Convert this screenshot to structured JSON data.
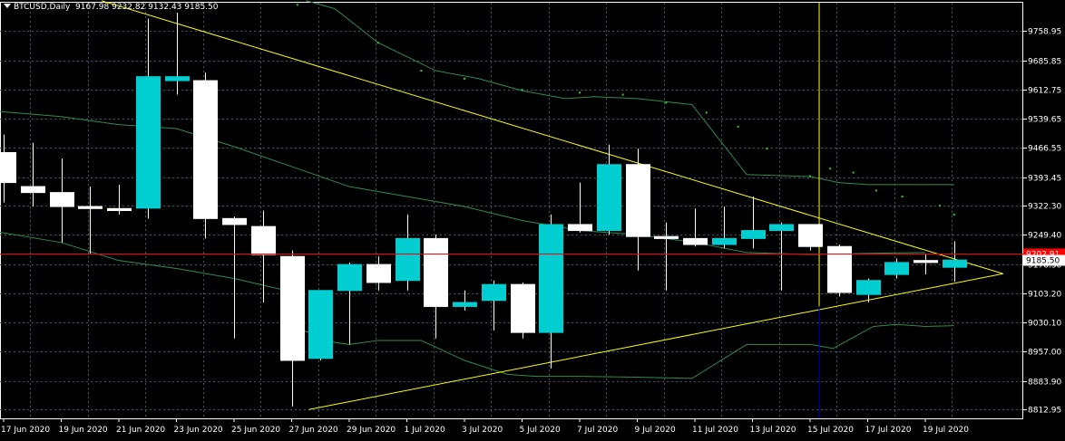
{
  "header": {
    "symbol": "BTCUSD,Daily",
    "ohlc": "9167.98 9232.82 9132.43 9185.50"
  },
  "colors": {
    "background": "#000000",
    "grid": "#415a6a",
    "bull": "#00ced1",
    "bear": "#ffffff",
    "wick": "#ffffff",
    "trendline": "#ffff00",
    "vline": "#ffff00",
    "vline_lower": "#0000cd",
    "ma": "#2e8b57",
    "dots": "#32cd32",
    "red_line": "#ff0000",
    "axis_text": "#ffffff"
  },
  "chart_data": {
    "type": "candlestick",
    "y_range": [
      8790,
      9830
    ],
    "y_ticks": [
      "9758.95",
      "9685.85",
      "9612.75",
      "9539.65",
      "9466.55",
      "9393.45",
      "9322.30",
      "9249.40",
      "9176.30",
      "9103.20",
      "9030.10",
      "8957.00",
      "8883.90",
      "8812.95"
    ],
    "x_ticks": [
      {
        "i": 0,
        "label": "17 Jun 2020"
      },
      {
        "i": 2,
        "label": "19 Jun 2020"
      },
      {
        "i": 4,
        "label": "21 Jun 2020"
      },
      {
        "i": 6,
        "label": "23 Jun 2020"
      },
      {
        "i": 8,
        "label": "25 Jun 2020"
      },
      {
        "i": 10,
        "label": "27 Jun 2020"
      },
      {
        "i": 12,
        "label": "29 Jun 2020"
      },
      {
        "i": 14,
        "label": "1 Jul 2020"
      },
      {
        "i": 16,
        "label": "3 Jul 2020"
      },
      {
        "i": 18,
        "label": "5 Jul 2020"
      },
      {
        "i": 20,
        "label": "7 Jul 2020"
      },
      {
        "i": 22,
        "label": "9 Jul 2020"
      },
      {
        "i": 24,
        "label": "11 Jul 2020"
      },
      {
        "i": 26,
        "label": "13 Jul 2020"
      },
      {
        "i": 28,
        "label": "15 Jul 2020"
      },
      {
        "i": 30,
        "label": "17 Jul 2020"
      },
      {
        "i": 32,
        "label": "19 Jul 2020"
      }
    ],
    "candles": [
      {
        "o": 9455,
        "h": 9500,
        "l": 9330,
        "c": 9380
      },
      {
        "o": 9370,
        "h": 9480,
        "l": 9320,
        "c": 9355
      },
      {
        "o": 9355,
        "h": 9440,
        "l": 9230,
        "c": 9320
      },
      {
        "o": 9320,
        "h": 9370,
        "l": 9200,
        "c": 9315
      },
      {
        "o": 9315,
        "h": 9375,
        "l": 9300,
        "c": 9310
      },
      {
        "o": 9316,
        "h": 9790,
        "l": 9290,
        "c": 9645
      },
      {
        "o": 9635,
        "h": 9805,
        "l": 9600,
        "c": 9645
      },
      {
        "o": 9635,
        "h": 9655,
        "l": 9240,
        "c": 9290
      },
      {
        "o": 9290,
        "h": 9295,
        "l": 8990,
        "c": 9275
      },
      {
        "o": 9270,
        "h": 9310,
        "l": 9080,
        "c": 9200
      },
      {
        "o": 9195,
        "h": 9210,
        "l": 8820,
        "c": 8935
      },
      {
        "o": 8940,
        "h": 9110,
        "l": 8935,
        "c": 9110
      },
      {
        "o": 9110,
        "h": 9180,
        "l": 8975,
        "c": 9175
      },
      {
        "o": 9175,
        "h": 9195,
        "l": 9110,
        "c": 9130
      },
      {
        "o": 9135,
        "h": 9300,
        "l": 9110,
        "c": 9240
      },
      {
        "o": 9240,
        "h": 9250,
        "l": 8990,
        "c": 9070
      },
      {
        "o": 9070,
        "h": 9110,
        "l": 9060,
        "c": 9080
      },
      {
        "o": 9085,
        "h": 9135,
        "l": 9010,
        "c": 9125
      },
      {
        "o": 9125,
        "h": 9130,
        "l": 8990,
        "c": 9005
      },
      {
        "o": 9005,
        "h": 9300,
        "l": 8915,
        "c": 9275
      },
      {
        "o": 9275,
        "h": 9380,
        "l": 9255,
        "c": 9260
      },
      {
        "o": 9260,
        "h": 9475,
        "l": 9250,
        "c": 9425
      },
      {
        "o": 9425,
        "h": 9465,
        "l": 9160,
        "c": 9245
      },
      {
        "o": 9245,
        "h": 9280,
        "l": 9110,
        "c": 9240
      },
      {
        "o": 9240,
        "h": 9315,
        "l": 9220,
        "c": 9225
      },
      {
        "o": 9225,
        "h": 9320,
        "l": 9215,
        "c": 9240
      },
      {
        "o": 9240,
        "h": 9345,
        "l": 9215,
        "c": 9260
      },
      {
        "o": 9260,
        "h": 9280,
        "l": 9110,
        "c": 9275
      },
      {
        "o": 9275,
        "h": 9275,
        "l": 9210,
        "c": 9220
      },
      {
        "o": 9220,
        "h": 9225,
        "l": 9095,
        "c": 9105
      },
      {
        "o": 9100,
        "h": 9140,
        "l": 9080,
        "c": 9135
      },
      {
        "o": 9150,
        "h": 9190,
        "l": 9140,
        "c": 9180
      },
      {
        "o": 9185,
        "h": 9200,
        "l": 9150,
        "c": 9180
      },
      {
        "o": 9168,
        "h": 9233,
        "l": 9132,
        "c": 9186
      }
    ],
    "current_price": {
      "value": 9185.5,
      "label": "9185.50"
    },
    "red_line": {
      "value": 9202.91,
      "label": "9202.91"
    },
    "trendlines": [
      {
        "i0": 3.4,
        "p0": 9835,
        "i1": 34.7,
        "p1": 9152
      },
      {
        "i0": 10.6,
        "p0": 8812,
        "i1": 34.7,
        "p1": 9152
      }
    ],
    "vertical_line_index": 28.3,
    "ma_middle": [
      [
        -0.5,
        9560
      ],
      [
        2,
        9545
      ],
      [
        4,
        9525
      ],
      [
        6,
        9515
      ],
      [
        8,
        9470
      ],
      [
        10,
        9420
      ],
      [
        12,
        9370
      ],
      [
        14,
        9345
      ],
      [
        16,
        9320
      ],
      [
        18,
        9285
      ],
      [
        20,
        9260
      ],
      [
        22,
        9250
      ],
      [
        24,
        9230
      ],
      [
        25.8,
        9205
      ],
      [
        28,
        9200
      ],
      [
        30,
        9203
      ],
      [
        32,
        9205
      ]
    ],
    "ma_upper": [
      [
        10.5,
        9835
      ],
      [
        11.5,
        9815
      ],
      [
        13,
        9730
      ],
      [
        15,
        9660
      ],
      [
        16.5,
        9640
      ],
      [
        18,
        9610
      ],
      [
        19.5,
        9590
      ],
      [
        20.5,
        9595
      ],
      [
        22,
        9590
      ],
      [
        23.9,
        9575
      ],
      [
        25.8,
        9400
      ],
      [
        28,
        9395
      ],
      [
        29,
        9380
      ],
      [
        30,
        9375
      ],
      [
        32,
        9375
      ],
      [
        33,
        9375
      ]
    ],
    "ma_lower": [
      [
        -0.5,
        9260
      ],
      [
        2,
        9230
      ],
      [
        4,
        9185
      ],
      [
        6,
        9165
      ],
      [
        8,
        9140
      ],
      [
        9.8,
        9110
      ],
      [
        10.4,
        9010
      ],
      [
        11.5,
        8980
      ],
      [
        12,
        8975
      ],
      [
        13,
        8985
      ],
      [
        14.5,
        8985
      ],
      [
        16,
        8935
      ],
      [
        17.5,
        8900
      ],
      [
        18.5,
        8895
      ],
      [
        20,
        8895
      ],
      [
        22,
        8893
      ],
      [
        23.9,
        8890
      ],
      [
        25.8,
        8975
      ],
      [
        28,
        8975
      ],
      [
        28.8,
        8965
      ],
      [
        30.2,
        9020
      ],
      [
        31,
        9025
      ],
      [
        32,
        9020
      ],
      [
        33,
        9022
      ]
    ],
    "dots": [
      [
        10.2,
        9825
      ],
      [
        13,
        9730
      ],
      [
        14.5,
        9660
      ],
      [
        16,
        9640
      ],
      [
        18,
        9612
      ],
      [
        20,
        9605
      ],
      [
        21.5,
        9600
      ],
      [
        23,
        9580
      ],
      [
        24.4,
        9555
      ],
      [
        25.5,
        9520
      ],
      [
        26.5,
        9465
      ],
      [
        28,
        9396
      ],
      [
        28.7,
        9415
      ],
      [
        29.5,
        9405
      ],
      [
        30.3,
        9360
      ],
      [
        31.2,
        9345
      ],
      [
        32.5,
        9322
      ],
      [
        33,
        9300
      ]
    ]
  }
}
